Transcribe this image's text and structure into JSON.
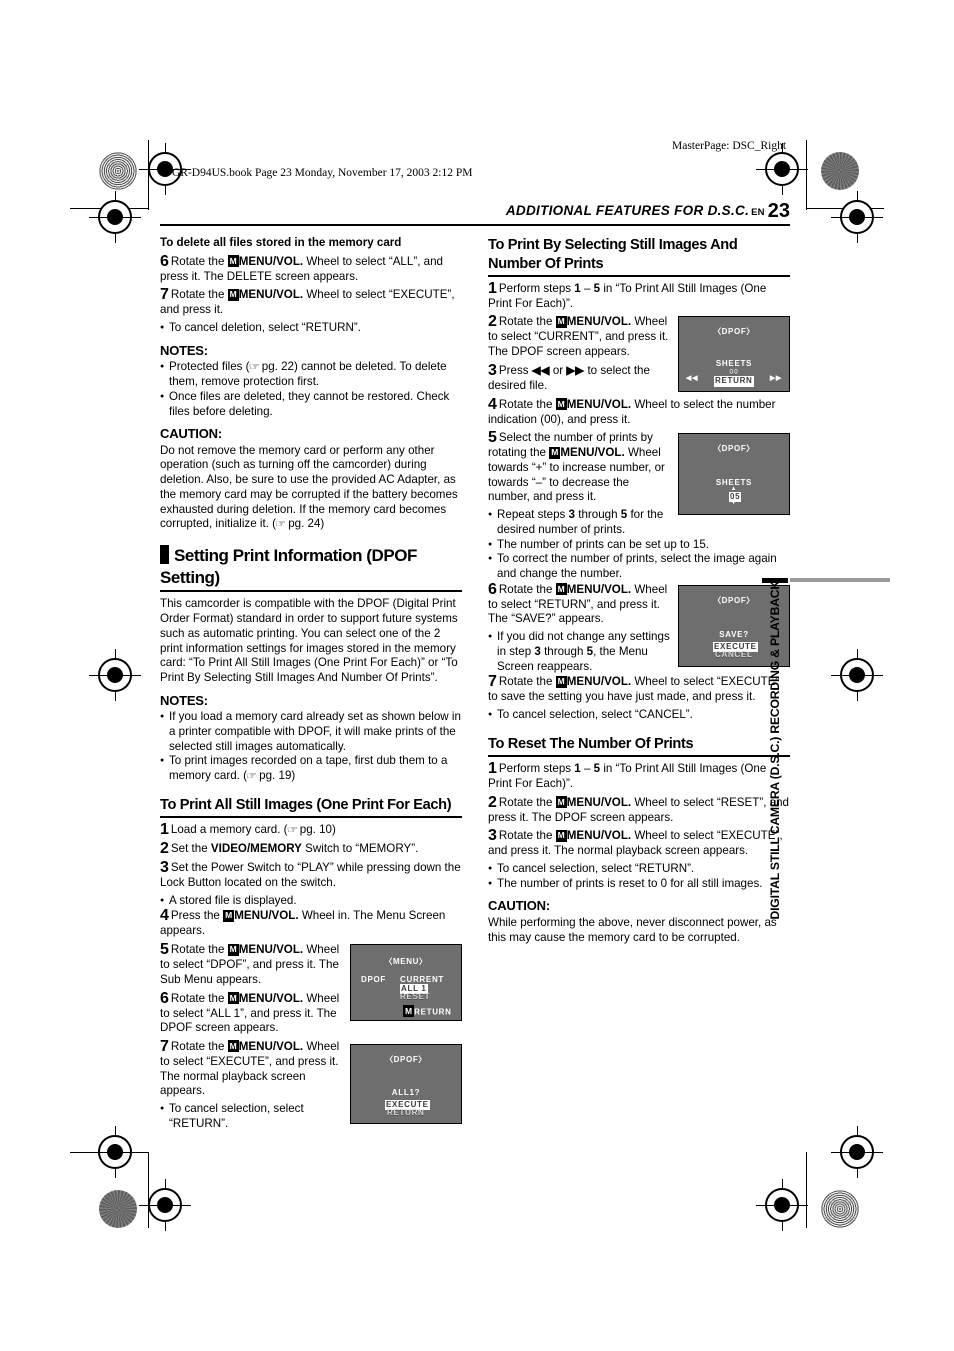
{
  "print_marks": {
    "masterpage": "MasterPage: DSC_Right",
    "bookline": "GR-D94US.book  Page 23  Monday, November 17, 2003  2:12 PM"
  },
  "running_head": {
    "title": "ADDITIONAL FEATURES FOR D.S.C.",
    "en": "EN",
    "page_number": "23"
  },
  "side_tab": {
    "label": "DIGITAL STILL CAMERA (D.S.C.) RECORDING & PLAYBACK"
  },
  "left_column": {
    "delete_section": {
      "heading": "To delete all files stored in the memory card",
      "step6": {
        "num": "6",
        "text_a": "Rotate the ",
        "icon": "M",
        "bold": "MENU/VOL.",
        "text_b": " Wheel to select “ALL”, and press it. The DELETE screen appears."
      },
      "step7": {
        "num": "7",
        "text_a": "Rotate the ",
        "icon": "M",
        "bold": "MENU/VOL.",
        "text_b": " Wheel to select “EXECUTE”, and press it."
      },
      "step7_bullet": "To cancel deletion, select “RETURN”.",
      "notes_heading": "NOTES:",
      "notes": [
        {
          "pre": "Protected files (",
          "ref": "pg. 22",
          "post": ") cannot be deleted. To delete them, remove protection first."
        },
        {
          "pre": "Once files are deleted, they cannot be restored. Check files before deleting.",
          "ref": "",
          "post": ""
        }
      ],
      "caution_heading": "CAUTION:",
      "caution_pre": "Do not remove the memory card or perform any other operation (such as turning off the camcorder) during deletion. Also, be sure to use the provided AC Adapter, as the memory card may be corrupted if the battery becomes exhausted during deletion. If the memory card becomes corrupted, initialize it. (",
      "caution_ref": "pg. 24",
      "caution_post": ")"
    },
    "dpof_section": {
      "heading": "Setting Print Information (DPOF Setting)",
      "intro": "This camcorder is compatible with the DPOF (Digital Print Order Format) standard in order to support future systems such as automatic printing. You can select one of the 2 print information settings for images stored in the memory card: “To Print All Still Images (One Print For Each)” or “To Print By Selecting Still Images And Number Of Prints”.",
      "notes_heading": "NOTES:",
      "notes": [
        {
          "pre": "If you load a memory card already set as shown below in a printer compatible with DPOF, it will make prints of the selected still images automatically.",
          "ref": "",
          "post": ""
        },
        {
          "pre": "To print images recorded on a tape, first dub them to a memory card. (",
          "ref": "pg. 19",
          "post": ")"
        }
      ]
    },
    "print_all_section": {
      "heading": "To Print All Still Images (One Print For Each)",
      "step1": {
        "num": "1",
        "pre": "Load a memory card. (",
        "ref": "pg. 10",
        "post": ")"
      },
      "step2": {
        "num": "2",
        "text_a": "Set the ",
        "bold": "VIDEO/MEMORY",
        "text_b": " Switch to “MEMORY”."
      },
      "step3": {
        "num": "3",
        "text": "Set the Power Switch to “PLAY” while pressing down the Lock Button located on the switch."
      },
      "step3_bullet": "A stored file is displayed.",
      "step4": {
        "num": "4",
        "text_a": "Press the ",
        "icon": "M",
        "bold": "MENU/VOL.",
        "text_b": " Wheel in. The Menu Screen appears."
      },
      "step5": {
        "num": "5",
        "text_a": "Rotate the ",
        "icon": "M",
        "bold": "MENU/VOL.",
        "text_b": " Wheel to select “DPOF”, and press it. The Sub Menu appears."
      },
      "step6": {
        "num": "6",
        "text_a": "Rotate the ",
        "icon": "M",
        "bold": "MENU/VOL.",
        "text_b": " Wheel to select “ALL 1”, and press it. The DPOF screen appears."
      },
      "step7": {
        "num": "7",
        "text_a": "Rotate the ",
        "icon": "M",
        "bold": "MENU/VOL.",
        "text_b": " Wheel to select “EXECUTE”, and press it. The normal playback screen appears."
      },
      "step7_bullet": "To cancel selection, select “RETURN”."
    },
    "lcd_menu": {
      "title": "〈MENU〉",
      "left_label": "DPOF",
      "items": [
        "CURRENT",
        "ALL  1",
        "RESET"
      ],
      "selected": "ALL  1",
      "return_icon": "M",
      "return_label": "RETURN"
    },
    "lcd_dpof_all": {
      "title": "〈DPOF〉",
      "prompt": "ALL1?",
      "items": [
        "EXECUTE",
        "RETURN"
      ],
      "selected": "EXECUTE"
    }
  },
  "right_column": {
    "select_section": {
      "heading": "To Print By Selecting Still Images And Number Of Prints",
      "step1": {
        "num": "1",
        "pre": "Perform steps ",
        "a": "1",
        "mid": " – ",
        "b": "5",
        "post": " in “To Print All Still Images (One Print For Each)”."
      },
      "step2": {
        "num": "2",
        "text_a": "Rotate the ",
        "icon": "M",
        "bold": "MENU/VOL.",
        "text_b": " Wheel to select “CURRENT”, and press it. The DPOF screen appears."
      },
      "step3": {
        "num": "3",
        "pre": "Press ",
        "rev": "◀◀",
        "mid": " or ",
        "fwd": "▶▶",
        "post": " to select the desired file."
      },
      "step4": {
        "num": "4",
        "text_a": "Rotate the ",
        "icon": "M",
        "bold": "MENU/VOL.",
        "text_b": " Wheel to select the number indication (00), and press it."
      },
      "step5": {
        "num": "5",
        "text_a": "Select the number of prints by rotating the ",
        "icon": "M",
        "bold": "MENU/VOL.",
        "text_b": " Wheel towards “+” to increase number, or towards “–” to decrease the number, and press it."
      },
      "step5_bullets": [
        {
          "pre": "Repeat steps ",
          "a": "3",
          "mid": " through ",
          "b": "5",
          "post": " for the desired number of prints."
        },
        {
          "pre": "The number of prints can be set up to 15.",
          "a": "",
          "mid": "",
          "b": "",
          "post": ""
        },
        {
          "pre": "To correct the number of prints, select the image again and change the number.",
          "a": "",
          "mid": "",
          "b": "",
          "post": ""
        }
      ],
      "step6": {
        "num": "6",
        "text_a": "Rotate the ",
        "icon": "M",
        "bold": "MENU/VOL.",
        "text_b": " Wheel to select “RETURN”, and press it. The “SAVE?” appears."
      },
      "step6_bullet": {
        "pre": "If you did not change any settings in step ",
        "a": "3",
        "mid": " through ",
        "b": "5",
        "post": ", the Menu Screen reappears."
      },
      "step7": {
        "num": "7",
        "text_a": "Rotate the ",
        "icon": "M",
        "bold": "MENU/VOL.",
        "text_b": " Wheel to select “EXECUTE” to save the setting you have just made, and press it."
      },
      "step7_bullet": "To cancel selection, select “CANCEL”."
    },
    "reset_section": {
      "heading": "To Reset The Number Of Prints",
      "step1": {
        "num": "1",
        "pre": "Perform steps ",
        "a": "1",
        "mid": " – ",
        "b": "5",
        "post": " in “To Print All Still Images (One Print For Each)”."
      },
      "step2": {
        "num": "2",
        "text_a": "Rotate the ",
        "icon": "M",
        "bold": "MENU/VOL.",
        "text_b": " Wheel to select “RESET”, and press it. The DPOF screen appears."
      },
      "step3": {
        "num": "3",
        "text_a": "Rotate the ",
        "icon": "M",
        "bold": "MENU/VOL.",
        "text_b": " Wheel to select “EXECUTE”, and press it. The normal playback screen appears."
      },
      "bullets": [
        "To cancel selection, select “RETURN”.",
        "The number of prints is reset to 0 for all still images."
      ],
      "caution_heading": "CAUTION:",
      "caution_text": "While performing the above, never disconnect power, as this may cause the memory card to be corrupted."
    },
    "lcd_sheets_return": {
      "title": "〈DPOF〉",
      "label": "SHEETS",
      "count": "00",
      "selected": "RETURN",
      "rev_icon": "◀◀",
      "fwd_icon": "▶▶"
    },
    "lcd_sheets_count": {
      "title": "〈DPOF〉",
      "label": "SHEETS",
      "up_icon": "▲",
      "count": "05",
      "down_icon": "▼"
    },
    "lcd_save": {
      "title": "〈DPOF〉",
      "prompt": "SAVE?",
      "items": [
        "EXECUTE",
        "CANCEL"
      ],
      "selected": "EXECUTE"
    }
  },
  "colors": {
    "lcd_background": "#6e6e6e",
    "ink": "#000000",
    "paper": "#ffffff",
    "grey_rule": "#9a9a9a"
  }
}
